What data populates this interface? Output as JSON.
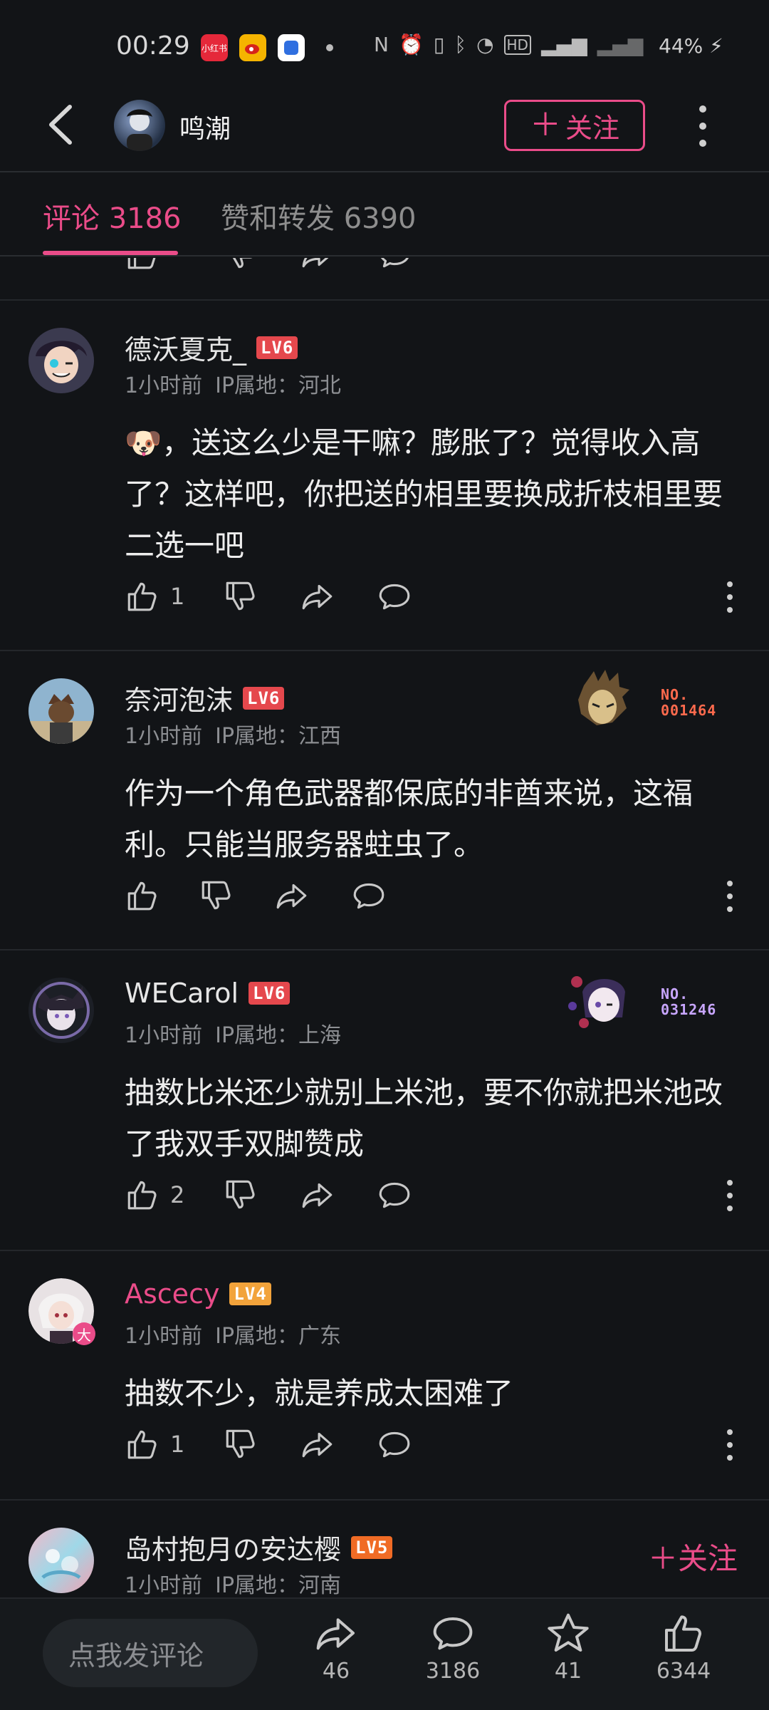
{
  "status_bar": {
    "time": "00:29",
    "battery": "44%",
    "apps": [
      {
        "icon": "xiaohongshu-icon",
        "label": "小红书",
        "color": "#e5283a"
      },
      {
        "icon": "weibo-icon",
        "label": "",
        "color": "#f5b400"
      },
      {
        "icon": "app-blue-icon",
        "label": "",
        "color": "#2f6fe0"
      }
    ]
  },
  "header": {
    "user_name": "鸣潮",
    "follow_label": "关注"
  },
  "tabs": [
    {
      "label": "评论 3186",
      "active": true
    },
    {
      "label": "赞和转发 6390",
      "active": false
    }
  ],
  "comments": [
    {
      "user": "德沃夏克_",
      "level": "LV6",
      "time": "1小时前",
      "ip": "IP属地：河北",
      "text": "，送这么少是干嘛？膨胀了？觉得收入高了？这样吧，你把送的相里要换成折枝相里要二选一吧",
      "emoji": "🐶",
      "likes": "1"
    },
    {
      "user": "奈河泡沫",
      "level": "LV6",
      "time": "1小时前",
      "ip": "IP属地：江西",
      "text": "作为一个角色武器都保底的非酋来说，这福利。只能当服务器蛀虫了。",
      "likes": "",
      "badge_no": "NO.\n001464"
    },
    {
      "user": "WECarol",
      "level": "LV6",
      "time": "1小时前",
      "ip": "IP属地：上海",
      "text": "抽数比米还少就别上米池，要不你就把米池改了我双手双脚赞成",
      "likes": "2",
      "badge_no": "NO.\n031246"
    },
    {
      "user": "Ascecy",
      "level": "LV4",
      "time": "1小时前",
      "ip": "IP属地：广东",
      "text": "抽数不少，就是养成太困难了",
      "likes": "1",
      "avatar_tag": "大"
    },
    {
      "user": "岛村抱月の安达樱",
      "level": "LV5",
      "time": "1小时前",
      "ip": "IP属地：河南",
      "follow_label": "关注"
    }
  ],
  "bottom_bar": {
    "comment_placeholder": "点我发评论",
    "share_count": "46",
    "comment_count": "3186",
    "favorite_count": "41",
    "like_count": "6344"
  },
  "colors": {
    "accent": "#ea4c89",
    "background": "#121417",
    "lv6": "#e5484d",
    "lv5": "#f06b25",
    "lv4": "#f2a33b"
  }
}
